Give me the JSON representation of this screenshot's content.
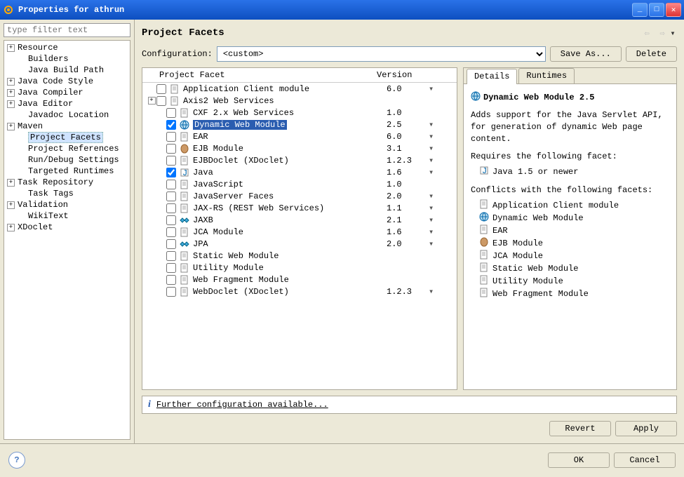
{
  "window": {
    "title": "Properties for athrun"
  },
  "sidebar": {
    "filter_placeholder": "type filter text",
    "items": [
      {
        "label": "Resource",
        "expandable": true
      },
      {
        "label": "Builders",
        "expandable": false
      },
      {
        "label": "Java Build Path",
        "expandable": false
      },
      {
        "label": "Java Code Style",
        "expandable": true
      },
      {
        "label": "Java Compiler",
        "expandable": true
      },
      {
        "label": "Java Editor",
        "expandable": true
      },
      {
        "label": "Javadoc Location",
        "expandable": false
      },
      {
        "label": "Maven",
        "expandable": true
      },
      {
        "label": "Project Facets",
        "expandable": false,
        "selected": true
      },
      {
        "label": "Project References",
        "expandable": false
      },
      {
        "label": "Run/Debug Settings",
        "expandable": false
      },
      {
        "label": "Targeted Runtimes",
        "expandable": false
      },
      {
        "label": "Task Repository",
        "expandable": true
      },
      {
        "label": "Task Tags",
        "expandable": false
      },
      {
        "label": "Validation",
        "expandable": true
      },
      {
        "label": "WikiText",
        "expandable": false
      },
      {
        "label": "XDoclet",
        "expandable": true
      }
    ]
  },
  "header": {
    "title": "Project Facets"
  },
  "config": {
    "label": "Configuration:",
    "value": "<custom>",
    "save_as": "Save As...",
    "delete": "Delete"
  },
  "facets": {
    "col_name": "Project Facet",
    "col_version": "Version",
    "rows": [
      {
        "name": "Application Client module",
        "version": "6.0",
        "checked": false,
        "dd": true,
        "icon": "doc"
      },
      {
        "name": "Axis2 Web Services",
        "version": "",
        "checked": false,
        "dd": false,
        "icon": "doc",
        "expandable": true
      },
      {
        "name": "CXF 2.x Web Services",
        "version": "1.0",
        "checked": false,
        "dd": false,
        "icon": "doc",
        "sub": true
      },
      {
        "name": "Dynamic Web Module",
        "version": "2.5",
        "checked": true,
        "dd": true,
        "icon": "globe",
        "sub": true,
        "selected": true
      },
      {
        "name": "EAR",
        "version": "6.0",
        "checked": false,
        "dd": true,
        "icon": "doc",
        "sub": true
      },
      {
        "name": "EJB Module",
        "version": "3.1",
        "checked": false,
        "dd": true,
        "icon": "bean",
        "sub": true
      },
      {
        "name": "EJBDoclet (XDoclet)",
        "version": "1.2.3",
        "checked": false,
        "dd": true,
        "icon": "doc",
        "sub": true
      },
      {
        "name": "Java",
        "version": "1.6",
        "checked": true,
        "dd": true,
        "icon": "java",
        "sub": true
      },
      {
        "name": "JavaScript",
        "version": "1.0",
        "checked": false,
        "dd": false,
        "icon": "doc",
        "sub": true
      },
      {
        "name": "JavaServer Faces",
        "version": "2.0",
        "checked": false,
        "dd": true,
        "icon": "doc",
        "sub": true
      },
      {
        "name": "JAX-RS (REST Web Services)",
        "version": "1.1",
        "checked": false,
        "dd": true,
        "icon": "doc",
        "sub": true
      },
      {
        "name": "JAXB",
        "version": "2.1",
        "checked": false,
        "dd": true,
        "icon": "jaxb",
        "sub": true
      },
      {
        "name": "JCA Module",
        "version": "1.6",
        "checked": false,
        "dd": true,
        "icon": "doc",
        "sub": true
      },
      {
        "name": "JPA",
        "version": "2.0",
        "checked": false,
        "dd": true,
        "icon": "jpa",
        "sub": true
      },
      {
        "name": "Static Web Module",
        "version": "",
        "checked": false,
        "dd": false,
        "icon": "doc",
        "sub": true
      },
      {
        "name": "Utility Module",
        "version": "",
        "checked": false,
        "dd": false,
        "icon": "doc",
        "sub": true
      },
      {
        "name": "Web Fragment Module",
        "version": "",
        "checked": false,
        "dd": false,
        "icon": "doc",
        "sub": true
      },
      {
        "name": "WebDoclet (XDoclet)",
        "version": "1.2.3",
        "checked": false,
        "dd": true,
        "icon": "doc",
        "sub": true
      }
    ]
  },
  "details": {
    "tab_details": "Details",
    "tab_runtimes": "Runtimes",
    "title": "Dynamic Web Module 2.5",
    "desc": "Adds support for the Java Servlet API, for generation of dynamic Web page content.",
    "requires_label": "Requires the following facet:",
    "requires": [
      {
        "label": "Java 1.5 or newer",
        "icon": "java"
      }
    ],
    "conflicts_label": "Conflicts with the following facets:",
    "conflicts": [
      {
        "label": "Application Client module",
        "icon": "doc"
      },
      {
        "label": "Dynamic Web Module",
        "icon": "globe"
      },
      {
        "label": "EAR",
        "icon": "doc"
      },
      {
        "label": "EJB Module",
        "icon": "bean"
      },
      {
        "label": "JCA Module",
        "icon": "doc"
      },
      {
        "label": "Static Web Module",
        "icon": "doc"
      },
      {
        "label": "Utility Module",
        "icon": "doc"
      },
      {
        "label": "Web Fragment Module",
        "icon": "doc"
      }
    ]
  },
  "info_bar": {
    "text": "Further configuration available..."
  },
  "actions": {
    "revert": "Revert",
    "apply": "Apply"
  },
  "footer": {
    "ok": "OK",
    "cancel": "Cancel"
  }
}
